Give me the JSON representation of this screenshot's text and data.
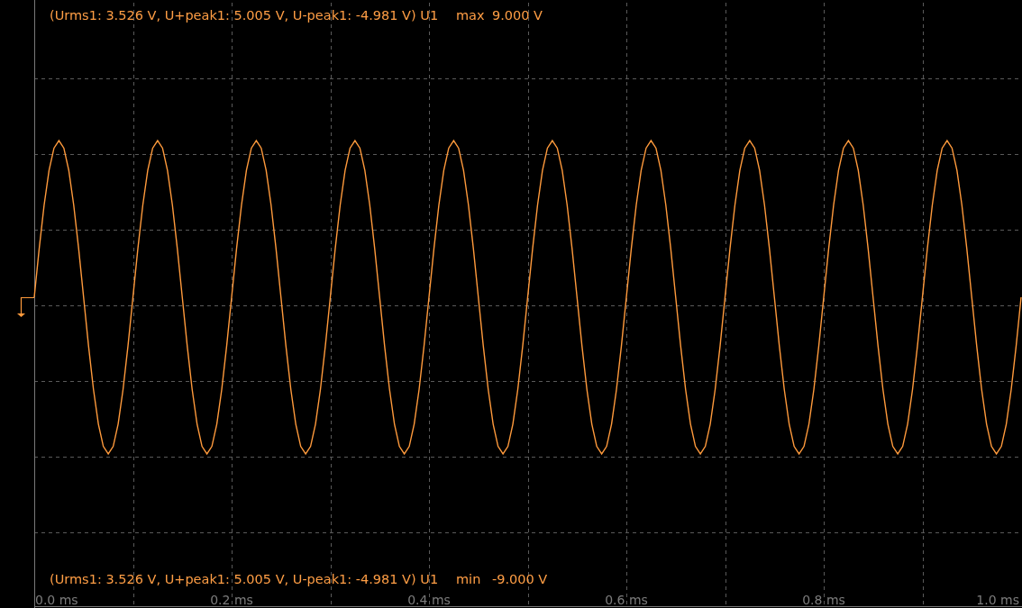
{
  "readouts": {
    "top": "(Urms1: 3.526 V, U+peak1: 5.005 V, U-peak1: -4.981 V) U1",
    "bottom": "(Urms1: 3.526 V, U+peak1: 5.005 V, U-peak1: -4.981 V) U1",
    "top_limit_caption": "max",
    "bottom_limit_caption": "min"
  },
  "chart_data": {
    "type": "line",
    "grid": true,
    "xlim": [
      0,
      1
    ],
    "ylim": [
      -9,
      9
    ],
    "yticks": [
      {
        "value": 9,
        "label": "9.000 V"
      },
      {
        "value": -9,
        "label": "-9.000 V"
      }
    ],
    "xticks": [
      {
        "value": 0,
        "label": "0.0 ms"
      },
      {
        "value": 0.2,
        "label": "0.2 ms"
      },
      {
        "value": 0.4,
        "label": "0.4 ms"
      },
      {
        "value": 0.6,
        "label": "0.6 ms"
      },
      {
        "value": 0.8,
        "label": "0.8 ms"
      },
      {
        "value": 1,
        "label": "1.0 ms"
      }
    ],
    "x": [
      0,
      0.005,
      0.01,
      0.015,
      0.02,
      0.025,
      0.03,
      0.035,
      0.04,
      0.045,
      0.05,
      0.055,
      0.06,
      0.065,
      0.07,
      0.075,
      0.08,
      0.085,
      0.09,
      0.095,
      0.1,
      0.105,
      0.11,
      0.115,
      0.12,
      0.125,
      0.13,
      0.135,
      0.14,
      0.145,
      0.15,
      0.155,
      0.16,
      0.165,
      0.17,
      0.175,
      0.18,
      0.185,
      0.19,
      0.195,
      0.2,
      0.205,
      0.21,
      0.215,
      0.22,
      0.225,
      0.23,
      0.235,
      0.24,
      0.245,
      0.25,
      0.255,
      0.26,
      0.265,
      0.27,
      0.275,
      0.28,
      0.285,
      0.29,
      0.295,
      0.3,
      0.305,
      0.31,
      0.315,
      0.32,
      0.325,
      0.33,
      0.335,
      0.34,
      0.345,
      0.35,
      0.355,
      0.36,
      0.365,
      0.37,
      0.375,
      0.38,
      0.385,
      0.39,
      0.395,
      0.4,
      0.405,
      0.41,
      0.415,
      0.42,
      0.425,
      0.43,
      0.435,
      0.44,
      0.445,
      0.45,
      0.455,
      0.46,
      0.465,
      0.47,
      0.475,
      0.48,
      0.485,
      0.49,
      0.495,
      0.5,
      0.505,
      0.51,
      0.515,
      0.52,
      0.525,
      0.53,
      0.535,
      0.54,
      0.545,
      0.55,
      0.555,
      0.56,
      0.565,
      0.57,
      0.575,
      0.58,
      0.585,
      0.59,
      0.595,
      0.6,
      0.605,
      0.61,
      0.615,
      0.62,
      0.625,
      0.63,
      0.635,
      0.64,
      0.645,
      0.65,
      0.655,
      0.66,
      0.665,
      0.67,
      0.675,
      0.68,
      0.685,
      0.69,
      0.695,
      0.7,
      0.705,
      0.71,
      0.715,
      0.72,
      0.725,
      0.73,
      0.735,
      0.74,
      0.745,
      0.75,
      0.755,
      0.76,
      0.765,
      0.77,
      0.775,
      0.78,
      0.785,
      0.79,
      0.795,
      0.8,
      0.805,
      0.81,
      0.815,
      0.82,
      0.825,
      0.83,
      0.835,
      0.84,
      0.845,
      0.85,
      0.855,
      0.86,
      0.865,
      0.87,
      0.875,
      0.88,
      0.885,
      0.89,
      0.895,
      0.9,
      0.905,
      0.91,
      0.915,
      0.92,
      0.925,
      0.93,
      0.935,
      0.94,
      0.945,
      0.95,
      0.955,
      0.96,
      0.965,
      0.97,
      0.975,
      0.98,
      0.985,
      0.99,
      0.995,
      1
    ],
    "series": [
      {
        "color": "#ff9a3c",
        "values": [
          0,
          1.55,
          2.94,
          4.05,
          4.76,
          5,
          4.76,
          4.05,
          2.94,
          1.55,
          0,
          -1.55,
          -2.94,
          -4.05,
          -4.76,
          -5,
          -4.76,
          -4.05,
          -2.94,
          -1.55,
          0,
          1.55,
          2.94,
          4.05,
          4.76,
          5,
          4.76,
          4.05,
          2.94,
          1.55,
          0,
          -1.55,
          -2.94,
          -4.05,
          -4.76,
          -5,
          -4.76,
          -4.05,
          -2.94,
          -1.55,
          0,
          1.55,
          2.94,
          4.05,
          4.76,
          5,
          4.76,
          4.05,
          2.94,
          1.55,
          0,
          -1.55,
          -2.94,
          -4.05,
          -4.76,
          -5,
          -4.76,
          -4.05,
          -2.94,
          -1.55,
          0,
          1.55,
          2.94,
          4.05,
          4.76,
          5,
          4.76,
          4.05,
          2.94,
          1.55,
          0,
          -1.55,
          -2.94,
          -4.05,
          -4.76,
          -5,
          -4.76,
          -4.05,
          -2.94,
          -1.55,
          0,
          1.55,
          2.94,
          4.05,
          4.76,
          5,
          4.76,
          4.05,
          2.94,
          1.55,
          0,
          -1.55,
          -2.94,
          -4.05,
          -4.76,
          -5,
          -4.76,
          -4.05,
          -2.94,
          -1.55,
          0,
          1.55,
          2.94,
          4.05,
          4.76,
          5,
          4.76,
          4.05,
          2.94,
          1.55,
          0,
          -1.55,
          -2.94,
          -4.05,
          -4.76,
          -5,
          -4.76,
          -4.05,
          -2.94,
          -1.55,
          0,
          1.55,
          2.94,
          4.05,
          4.76,
          5,
          4.76,
          4.05,
          2.94,
          1.55,
          0,
          -1.55,
          -2.94,
          -4.05,
          -4.76,
          -5,
          -4.76,
          -4.05,
          -2.94,
          -1.55,
          0,
          1.55,
          2.94,
          4.05,
          4.76,
          5,
          4.76,
          4.05,
          2.94,
          1.55,
          0,
          -1.55,
          -2.94,
          -4.05,
          -4.76,
          -5,
          -4.76,
          -4.05,
          -2.94,
          -1.55,
          0,
          1.55,
          2.94,
          4.05,
          4.76,
          5,
          4.76,
          4.05,
          2.94,
          1.55,
          0,
          -1.55,
          -2.94,
          -4.05,
          -4.76,
          -5,
          -4.76,
          -4.05,
          -2.94,
          -1.55,
          0,
          1.55,
          2.94,
          4.05,
          4.76,
          5,
          4.76,
          4.05,
          2.94,
          1.55,
          0,
          -1.55,
          -2.94,
          -4.05,
          -4.76,
          -5,
          -4.76,
          -4.05,
          -2.94,
          -1.55,
          0
        ]
      }
    ]
  }
}
